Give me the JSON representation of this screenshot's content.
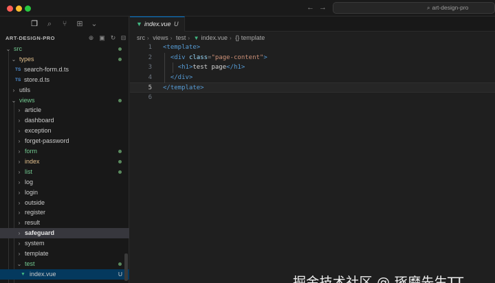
{
  "window": {
    "search_text": "art-design-pro"
  },
  "explorer": {
    "title": "ART-DESIGN-PRO"
  },
  "tree": [
    {
      "label": "src",
      "depth": 0,
      "chevron": "down",
      "color": "green",
      "dot": true
    },
    {
      "label": "types",
      "depth": 1,
      "chevron": "down",
      "color": "yellow",
      "dot": true
    },
    {
      "label": "search-form.d.ts",
      "depth": 2,
      "badge": "TS",
      "color": "normal"
    },
    {
      "label": "store.d.ts",
      "depth": 2,
      "badge": "TS",
      "color": "normal"
    },
    {
      "label": "utils",
      "depth": 1,
      "chevron": "right",
      "color": "normal"
    },
    {
      "label": "views",
      "depth": 1,
      "chevron": "down",
      "color": "green",
      "dot": true
    },
    {
      "label": "article",
      "depth": 2,
      "chevron": "right",
      "color": "normal"
    },
    {
      "label": "dashboard",
      "depth": 2,
      "chevron": "right",
      "color": "normal"
    },
    {
      "label": "exception",
      "depth": 2,
      "chevron": "right",
      "color": "normal"
    },
    {
      "label": "forget-password",
      "depth": 2,
      "chevron": "right",
      "color": "normal"
    },
    {
      "label": "form",
      "depth": 2,
      "chevron": "right",
      "color": "green",
      "dot": true
    },
    {
      "label": "index",
      "depth": 2,
      "chevron": "right",
      "color": "yellow",
      "dot": true
    },
    {
      "label": "list",
      "depth": 2,
      "chevron": "right",
      "color": "green",
      "dot": true
    },
    {
      "label": "log",
      "depth": 2,
      "chevron": "right",
      "color": "normal"
    },
    {
      "label": "login",
      "depth": 2,
      "chevron": "right",
      "color": "normal"
    },
    {
      "label": "outside",
      "depth": 2,
      "chevron": "right",
      "color": "normal"
    },
    {
      "label": "register",
      "depth": 2,
      "chevron": "right",
      "color": "normal"
    },
    {
      "label": "result",
      "depth": 2,
      "chevron": "right",
      "color": "normal"
    },
    {
      "label": "safeguard",
      "depth": 2,
      "chevron": "right",
      "color": "bold",
      "selected": true
    },
    {
      "label": "system",
      "depth": 2,
      "chevron": "right",
      "color": "normal"
    },
    {
      "label": "template",
      "depth": 2,
      "chevron": "right",
      "color": "normal"
    },
    {
      "label": "test",
      "depth": 2,
      "chevron": "down",
      "color": "green",
      "dot": true
    },
    {
      "label": "index.vue",
      "depth": 3,
      "badge": "V",
      "color": "normal",
      "status": "U",
      "active": true
    }
  ],
  "tab": {
    "label": "index.vue",
    "status": "U"
  },
  "breadcrumb": [
    "src",
    "views",
    "test",
    "index.vue",
    "{} template"
  ],
  "code": [
    {
      "n": "1",
      "tokens": [
        [
          "tg",
          "<template>"
        ]
      ]
    },
    {
      "n": "2",
      "tokens": [
        [
          "tx",
          "  "
        ],
        [
          "tg",
          "<div"
        ],
        [
          "tx",
          " "
        ],
        [
          "at",
          "class"
        ],
        [
          "pn",
          "="
        ],
        [
          "st",
          "\"page-content\""
        ],
        [
          "tg",
          ">"
        ]
      ]
    },
    {
      "n": "3",
      "tokens": [
        [
          "tx",
          "    "
        ],
        [
          "tg",
          "<h1>"
        ],
        [
          "tx",
          "test page"
        ],
        [
          "tg",
          "</h1>"
        ]
      ]
    },
    {
      "n": "4",
      "tokens": [
        [
          "tx",
          "  "
        ],
        [
          "tg",
          "</div>"
        ]
      ]
    },
    {
      "n": "5",
      "tokens": [
        [
          "tg",
          "</template>"
        ]
      ],
      "current": true
    },
    {
      "n": "6",
      "tokens": []
    }
  ],
  "watermark": "掘金技术社区 @ 琢磨先生TT"
}
